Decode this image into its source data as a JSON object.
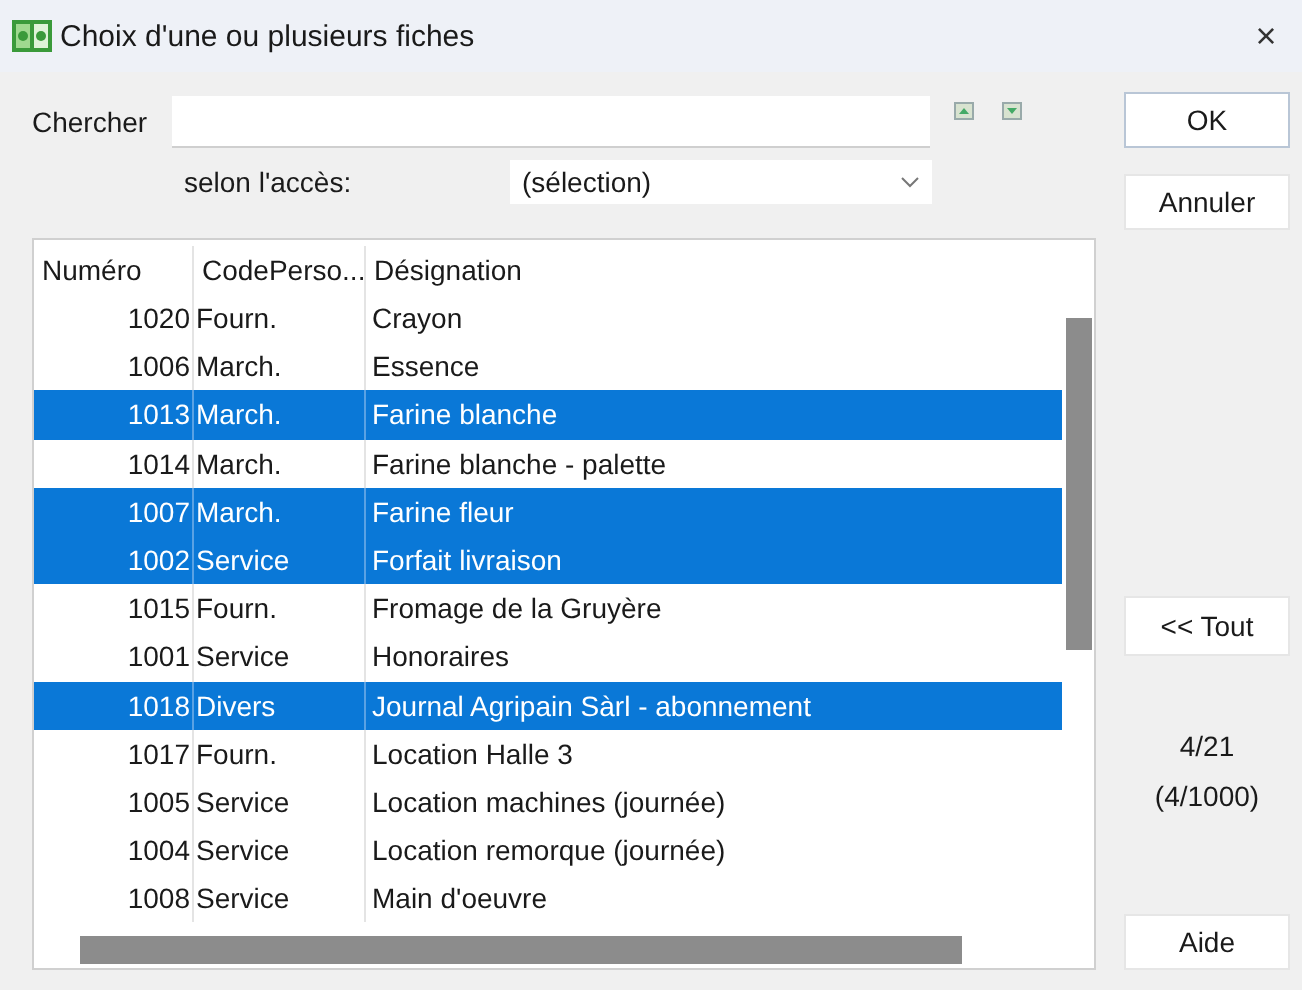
{
  "window": {
    "title": "Choix d'une ou plusieurs fiches",
    "close": "×"
  },
  "search": {
    "label": "Chercher"
  },
  "access": {
    "label": "selon l'accès:",
    "value": "(sélection)"
  },
  "list": {
    "columns": [
      "Numéro",
      "CodePerso...",
      "Désignation"
    ],
    "rows": [
      {
        "cells": [
          "1020",
          "Fourn.",
          "Crayon"
        ],
        "selected": false
      },
      {
        "cells": [
          "1006",
          "March.",
          "Essence"
        ],
        "selected": false
      },
      {
        "cells": [
          "1013",
          "March.",
          "Farine blanche"
        ],
        "selected": true
      },
      {
        "cells": [
          "1014",
          "March.",
          "Farine blanche - palette"
        ],
        "selected": false
      },
      {
        "cells": [
          "1007",
          "March.",
          "Farine fleur"
        ],
        "selected": true
      },
      {
        "cells": [
          "1002",
          "Service",
          "Forfait livraison"
        ],
        "selected": true
      },
      {
        "cells": [
          "1015",
          "Fourn.",
          "Fromage de la Gruyère"
        ],
        "selected": false
      },
      {
        "cells": [
          "1001",
          "Service",
          "Honoraires"
        ],
        "selected": false
      },
      {
        "cells": [
          "1018",
          "Divers",
          "Journal Agripain Sàrl - abonnement"
        ],
        "selected": true
      },
      {
        "cells": [
          "1017",
          "Fourn.",
          "Location Halle 3"
        ],
        "selected": false
      },
      {
        "cells": [
          "1005",
          "Service",
          "Location machines (journée)"
        ],
        "selected": false
      },
      {
        "cells": [
          "1004",
          "Service",
          "Location remorque (journée)"
        ],
        "selected": false
      },
      {
        "cells": [
          "1008",
          "Service",
          "Main d'oeuvre"
        ],
        "selected": false
      }
    ]
  },
  "buttons": {
    "ok": "OK",
    "cancel": "Annuler",
    "all": "<< Tout",
    "help": "Aide"
  },
  "counts": {
    "selected": "4/21",
    "total": "(4/1000)"
  }
}
